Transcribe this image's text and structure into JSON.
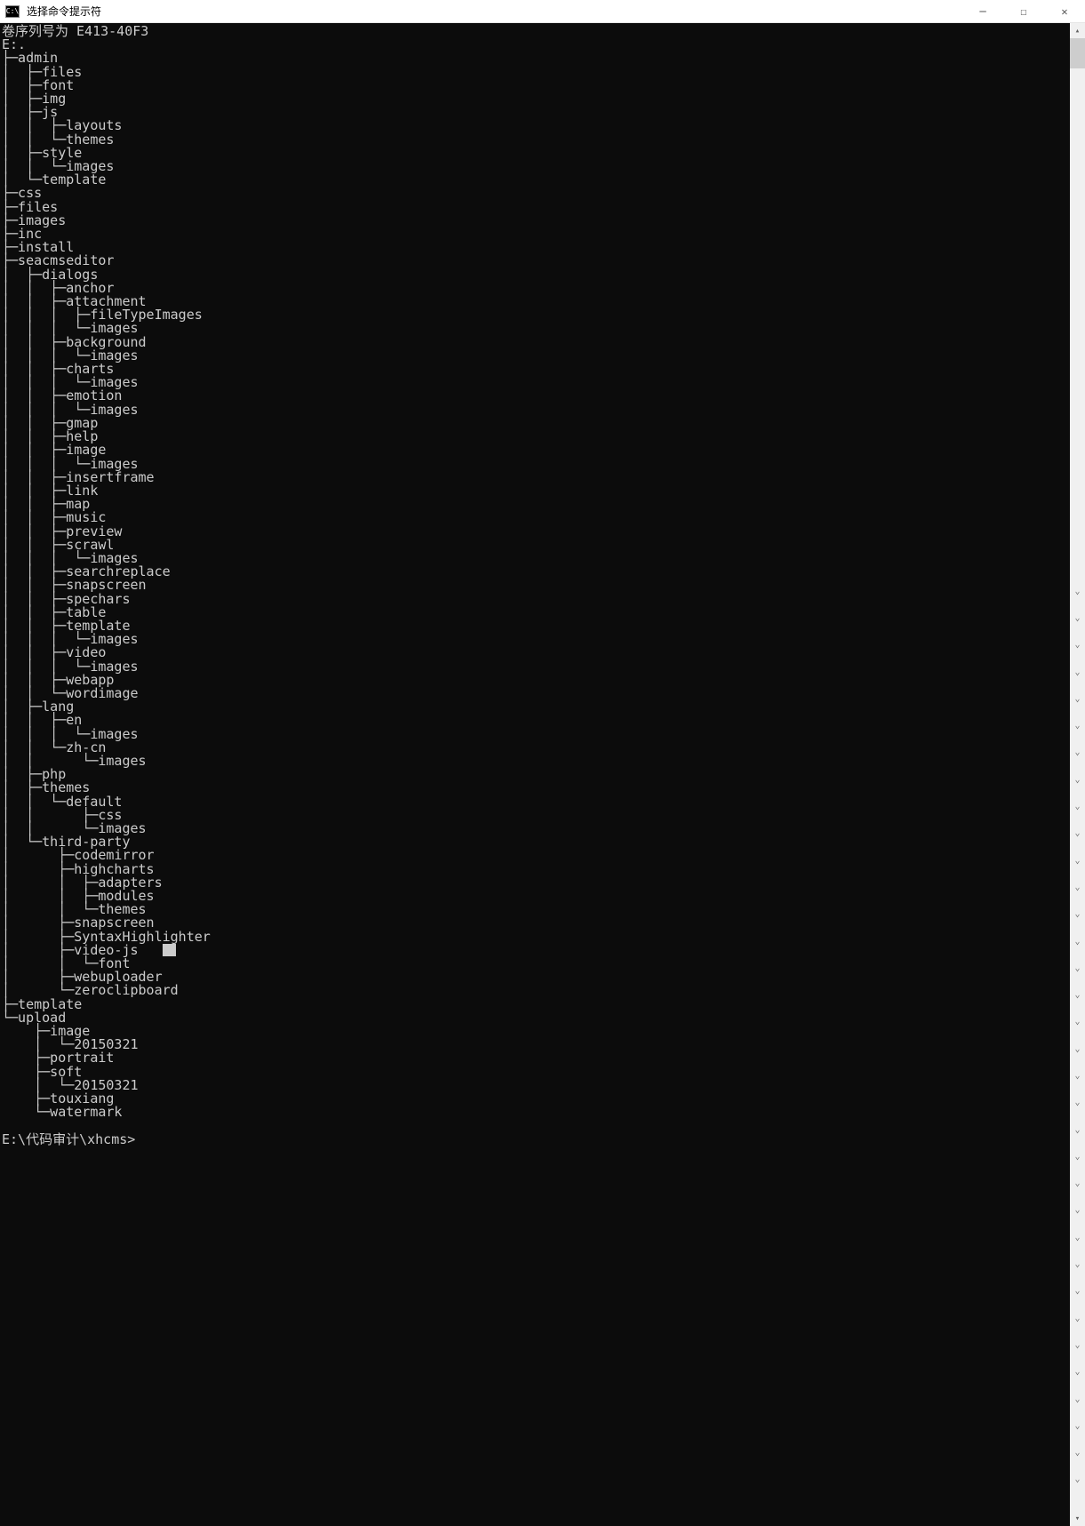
{
  "window": {
    "title": "选择命令提示符",
    "icon": "CMD"
  },
  "header_line": "卷序列号为 E413-40F3",
  "root": "E:.",
  "tree": [
    {
      "prefix": "├─",
      "name": "admin"
    },
    {
      "prefix": "│  ├─",
      "name": "files"
    },
    {
      "prefix": "│  ├─",
      "name": "font"
    },
    {
      "prefix": "│  ├─",
      "name": "img"
    },
    {
      "prefix": "│  ├─",
      "name": "js"
    },
    {
      "prefix": "│  │  ├─",
      "name": "layouts"
    },
    {
      "prefix": "│  │  └─",
      "name": "themes"
    },
    {
      "prefix": "│  ├─",
      "name": "style"
    },
    {
      "prefix": "│  │  └─",
      "name": "images"
    },
    {
      "prefix": "│  └─",
      "name": "template"
    },
    {
      "prefix": "├─",
      "name": "css"
    },
    {
      "prefix": "├─",
      "name": "files"
    },
    {
      "prefix": "├─",
      "name": "images"
    },
    {
      "prefix": "├─",
      "name": "inc"
    },
    {
      "prefix": "├─",
      "name": "install"
    },
    {
      "prefix": "├─",
      "name": "seacmseditor"
    },
    {
      "prefix": "│  ├─",
      "name": "dialogs"
    },
    {
      "prefix": "│  │  ├─",
      "name": "anchor"
    },
    {
      "prefix": "│  │  ├─",
      "name": "attachment"
    },
    {
      "prefix": "│  │  │  ├─",
      "name": "fileTypeImages"
    },
    {
      "prefix": "│  │  │  └─",
      "name": "images"
    },
    {
      "prefix": "│  │  ├─",
      "name": "background"
    },
    {
      "prefix": "│  │  │  └─",
      "name": "images"
    },
    {
      "prefix": "│  │  ├─",
      "name": "charts"
    },
    {
      "prefix": "│  │  │  └─",
      "name": "images"
    },
    {
      "prefix": "│  │  ├─",
      "name": "emotion"
    },
    {
      "prefix": "│  │  │  └─",
      "name": "images"
    },
    {
      "prefix": "│  │  ├─",
      "name": "gmap"
    },
    {
      "prefix": "│  │  ├─",
      "name": "help"
    },
    {
      "prefix": "│  │  ├─",
      "name": "image"
    },
    {
      "prefix": "│  │  │  └─",
      "name": "images"
    },
    {
      "prefix": "│  │  ├─",
      "name": "insertframe"
    },
    {
      "prefix": "│  │  ├─",
      "name": "link"
    },
    {
      "prefix": "│  │  ├─",
      "name": "map"
    },
    {
      "prefix": "│  │  ├─",
      "name": "music"
    },
    {
      "prefix": "│  │  ├─",
      "name": "preview"
    },
    {
      "prefix": "│  │  ├─",
      "name": "scrawl"
    },
    {
      "prefix": "│  │  │  └─",
      "name": "images"
    },
    {
      "prefix": "│  │  ├─",
      "name": "searchreplace"
    },
    {
      "prefix": "│  │  ├─",
      "name": "snapscreen"
    },
    {
      "prefix": "│  │  ├─",
      "name": "spechars"
    },
    {
      "prefix": "│  │  ├─",
      "name": "table"
    },
    {
      "prefix": "│  │  ├─",
      "name": "template"
    },
    {
      "prefix": "│  │  │  └─",
      "name": "images"
    },
    {
      "prefix": "│  │  ├─",
      "name": "video"
    },
    {
      "prefix": "│  │  │  └─",
      "name": "images"
    },
    {
      "prefix": "│  │  ├─",
      "name": "webapp"
    },
    {
      "prefix": "│  │  └─",
      "name": "wordimage"
    },
    {
      "prefix": "│  ├─",
      "name": "lang"
    },
    {
      "prefix": "│  │  ├─",
      "name": "en"
    },
    {
      "prefix": "│  │  │  └─",
      "name": "images"
    },
    {
      "prefix": "│  │  └─",
      "name": "zh-cn"
    },
    {
      "prefix": "│  │      └─",
      "name": "images"
    },
    {
      "prefix": "│  ├─",
      "name": "php"
    },
    {
      "prefix": "│  ├─",
      "name": "themes"
    },
    {
      "prefix": "│  │  └─",
      "name": "default"
    },
    {
      "prefix": "│  │      ├─",
      "name": "css"
    },
    {
      "prefix": "│  │      └─",
      "name": "images"
    },
    {
      "prefix": "│  └─",
      "name": "third-party"
    },
    {
      "prefix": "│      ├─",
      "name": "codemirror"
    },
    {
      "prefix": "│      ├─",
      "name": "highcharts"
    },
    {
      "prefix": "│      │  ├─",
      "name": "adapters"
    },
    {
      "prefix": "│      │  ├─",
      "name": "modules"
    },
    {
      "prefix": "│      │  └─",
      "name": "themes"
    },
    {
      "prefix": "│      ├─",
      "name": "snapscreen"
    },
    {
      "prefix": "│      ├─",
      "name": "SyntaxHighlighter"
    },
    {
      "prefix": "│      ├─",
      "name": "video-js",
      "cursor": true
    },
    {
      "prefix": "│      │  └─",
      "name": "font"
    },
    {
      "prefix": "│      ├─",
      "name": "webuploader"
    },
    {
      "prefix": "│      └─",
      "name": "zeroclipboard"
    },
    {
      "prefix": "├─",
      "name": "template"
    },
    {
      "prefix": "└─",
      "name": "upload"
    },
    {
      "prefix": "    ├─",
      "name": "image"
    },
    {
      "prefix": "    │  └─",
      "name": "20150321"
    },
    {
      "prefix": "    ├─",
      "name": "portrait"
    },
    {
      "prefix": "    ├─",
      "name": "soft"
    },
    {
      "prefix": "    │  └─",
      "name": "20150321"
    },
    {
      "prefix": "    ├─",
      "name": "touxiang"
    },
    {
      "prefix": "    └─",
      "name": "watermark"
    }
  ],
  "blank": "",
  "prompt": "E:\\代码审计\\xhcms>",
  "down_arrows_count": 34
}
